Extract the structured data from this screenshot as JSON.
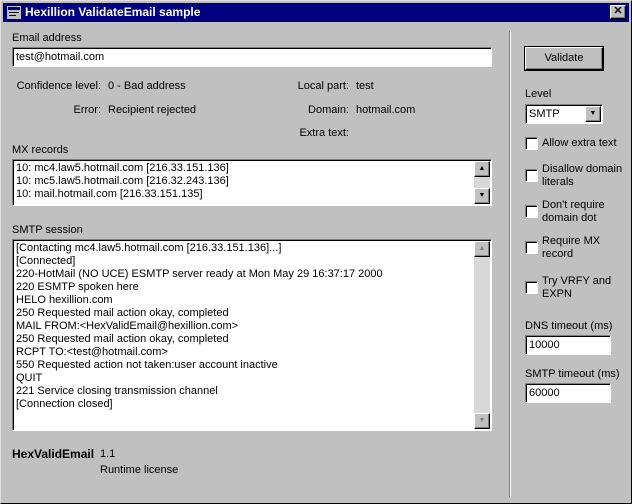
{
  "window": {
    "title": "Hexillion ValidateEmail sample",
    "close_glyph": "✕"
  },
  "email": {
    "label": "Email address",
    "value": "test@hotmail.com"
  },
  "results": {
    "confidence_label": "Confidence level:",
    "confidence_value": "0 - Bad address",
    "error_label": "Error:",
    "error_value": "Recipient rejected",
    "localpart_label": "Local part:",
    "localpart_value": "test",
    "domain_label": "Domain:",
    "domain_value": "hotmail.com",
    "extra_label": "Extra text:"
  },
  "mx": {
    "label": "MX records",
    "lines": [
      "10: mc4.law5.hotmail.com [216.33.151.136]",
      "10: mc5.law5.hotmail.com [216.32.243.136]",
      "10: mail.hotmail.com [216.33.151.135]"
    ]
  },
  "smtp": {
    "label": "SMTP session",
    "lines": [
      "[Contacting mc4.law5.hotmail.com [216.33.151.136]...]",
      "[Connected]",
      "220-HotMail (NO UCE) ESMTP server ready at Mon May 29 16:37:17 2000",
      "220 ESMTP spoken here",
      "HELO hexillion.com",
      "250 Requested mail action okay, completed",
      "MAIL FROM:<HexValidEmail@hexillion.com>",
      "250 Requested mail action okay, completed",
      "RCPT TO:<test@hotmail.com>",
      "550 Requested action not taken:user account inactive",
      "QUIT",
      "221 Service closing transmission channel",
      "[Connection closed]"
    ]
  },
  "footer": {
    "product": "HexValidEmail",
    "version": "1.1",
    "license": "Runtime license"
  },
  "side": {
    "validate_label": "Validate",
    "level_label": "Level",
    "level_value": "SMTP",
    "opt_allow_extra": "Allow extra text",
    "opt_disallow_literals_1": "Disallow domain",
    "opt_disallow_literals_2": "literals",
    "opt_no_domain_dot_1": "Don't require",
    "opt_no_domain_dot_2": "domain dot",
    "opt_require_mx_1": "Require MX",
    "opt_require_mx_2": "record",
    "opt_vrfy_1": "Try VRFY and",
    "opt_vrfy_2": "EXPN",
    "dns_label": "DNS timeout (ms)",
    "dns_value": "10000",
    "smtp_timeout_label": "SMTP timeout (ms)",
    "smtp_timeout_value": "60000"
  },
  "glyphs": {
    "up": "▲",
    "down": "▼"
  }
}
